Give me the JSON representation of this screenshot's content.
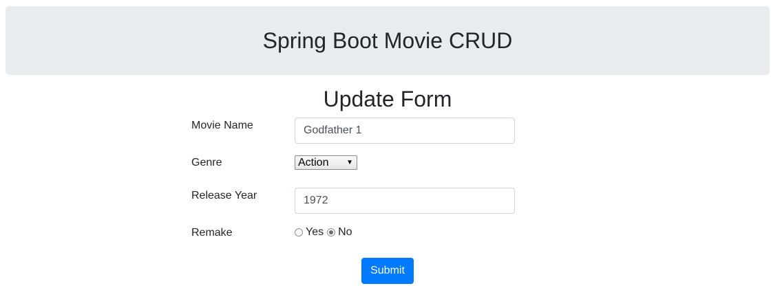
{
  "header": {
    "title": "Spring Boot Movie CRUD"
  },
  "form": {
    "title": "Update Form",
    "movie_name": {
      "label": "Movie Name",
      "value": "Godfather 1"
    },
    "genre": {
      "label": "Genre",
      "selected": "Action"
    },
    "release_year": {
      "label": "Release Year",
      "value": "1972"
    },
    "remake": {
      "label": "Remake",
      "options": [
        {
          "label": "Yes",
          "checked": false
        },
        {
          "label": "No",
          "checked": true
        }
      ]
    },
    "submit_label": "Submit"
  },
  "colors": {
    "header_bg": "#e9ecef",
    "primary": "#007bff"
  }
}
